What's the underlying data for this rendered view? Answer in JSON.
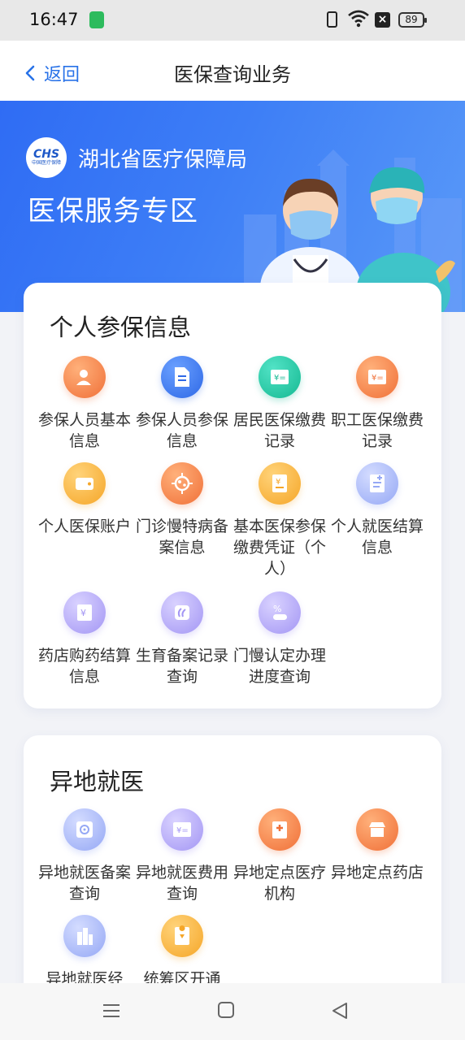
{
  "status": {
    "time": "16:47",
    "battery": "89"
  },
  "nav": {
    "back_label": "返回",
    "title": "医保查询业务"
  },
  "banner": {
    "org_name": "湖北省医疗保障局",
    "zone_title": "医保服务专区",
    "logo_text": "CHS",
    "logo_sub": "中国医疗保障"
  },
  "sections": [
    {
      "title": "个人参保信息",
      "items": [
        {
          "label": "参保人员基本信息",
          "icon": "person-icon"
        },
        {
          "label": "参保人员参保信息",
          "icon": "document-icon"
        },
        {
          "label": "居民医保缴费记录",
          "icon": "receipt-icon"
        },
        {
          "label": "职工医保缴费记录",
          "icon": "receipt-icon"
        },
        {
          "label": "个人医保账户",
          "icon": "wallet-icon"
        },
        {
          "label": "门诊慢特病备案信息",
          "icon": "virus-icon"
        },
        {
          "label": "基本医保参保缴费凭证（个人）",
          "icon": "voucher-icon"
        },
        {
          "label": "个人就医结算信息",
          "icon": "medical-record-icon"
        },
        {
          "label": "药店购药结算信息",
          "icon": "pharmacy-bill-icon"
        },
        {
          "label": "生育备案记录查询",
          "icon": "maternity-icon"
        },
        {
          "label": "门慢认定办理进度查询",
          "icon": "pill-progress-icon"
        }
      ]
    },
    {
      "title": "异地就医",
      "items": [
        {
          "label": "异地就医备案查询",
          "icon": "safe-icon"
        },
        {
          "label": "异地就医费用查询",
          "icon": "receipt-icon"
        },
        {
          "label": "异地定点医疗机构",
          "icon": "hospital-icon"
        },
        {
          "label": "异地定点药店",
          "icon": "store-icon"
        },
        {
          "label": "异地就医经",
          "icon": "building-icon"
        },
        {
          "label": "统筹区开通",
          "icon": "location-doc-icon"
        }
      ]
    }
  ],
  "colors": {
    "accent": "#2872e8",
    "banner": "#3d7ef6"
  }
}
